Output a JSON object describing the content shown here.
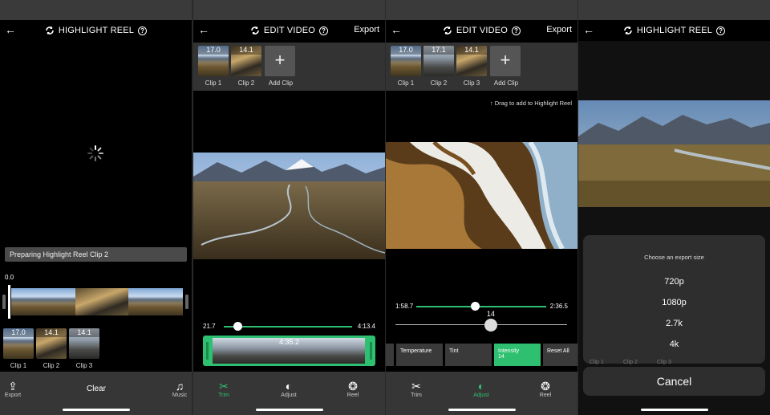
{
  "screen1": {
    "title": "HIGHLIGHT REEL",
    "status_message": "Preparing Highlight Reel Clip 2",
    "time_start": "0.0",
    "clips": [
      {
        "duration": "17.0",
        "label": "Clip 1"
      },
      {
        "duration": "14.1",
        "label": "Clip 2"
      },
      {
        "duration": "14.1",
        "label": "Clip 3"
      }
    ],
    "bottom": {
      "export_label": "Export",
      "clear_label": "Clear",
      "music_label": "Music"
    }
  },
  "screen2": {
    "title": "EDIT VIDEO",
    "export_label": "Export",
    "clips": [
      {
        "duration": "17.0",
        "label": "Clip 1"
      },
      {
        "duration": "14.1",
        "label": "Clip 2"
      }
    ],
    "add_clip_label": "Add Clip",
    "trim_start": "21.7",
    "trim_end": "4:13.4",
    "trim_knob_fraction": 0.08,
    "filmstrip_duration": "4:35.2",
    "tabs": [
      {
        "label": "Trim",
        "icon": "scissors-icon",
        "active": true
      },
      {
        "label": "Adjust",
        "icon": "half-circle-icon",
        "active": false
      },
      {
        "label": "Reel",
        "icon": "reel-icon",
        "active": false
      }
    ]
  },
  "screen3": {
    "title": "EDIT VIDEO",
    "export_label": "Export",
    "clips": [
      {
        "duration": "17.0",
        "label": "Clip 1"
      },
      {
        "duration": "17.1",
        "label": "Clip 2"
      },
      {
        "duration": "14.1",
        "label": "Clip 3"
      }
    ],
    "add_clip_label": "Add Clip",
    "drag_hint": "Drag to add to Highlight Reel",
    "range_start": "1:58.7",
    "range_end": "2:36.5",
    "range_knob_fraction": 0.45,
    "intensity_value": "14",
    "intensity_fraction": 0.56,
    "adjust_buttons": [
      {
        "label": "Temperature",
        "value": "",
        "active": false
      },
      {
        "label": "Tint",
        "value": "",
        "active": false
      },
      {
        "label": "Intensity",
        "value": "14",
        "active": true
      },
      {
        "label": "Reset All",
        "value": "",
        "active": false
      }
    ],
    "tabs": [
      {
        "label": "Trim",
        "icon": "scissors-icon",
        "active": false
      },
      {
        "label": "Adjust",
        "icon": "half-circle-icon",
        "active": true
      },
      {
        "label": "Reel",
        "icon": "reel-icon",
        "active": false
      }
    ]
  },
  "screen4": {
    "title": "HIGHLIGHT REEL",
    "sheet_title": "Choose an export size",
    "options": [
      "720p",
      "1080p",
      "2.7k",
      "4k"
    ],
    "behind_clips": [
      "Clip 1",
      "Clip 2",
      "Clip 3"
    ],
    "cancel_label": "Cancel"
  },
  "colors": {
    "accent": "#2fbf71",
    "bar": "#363636",
    "background": "#000000"
  }
}
